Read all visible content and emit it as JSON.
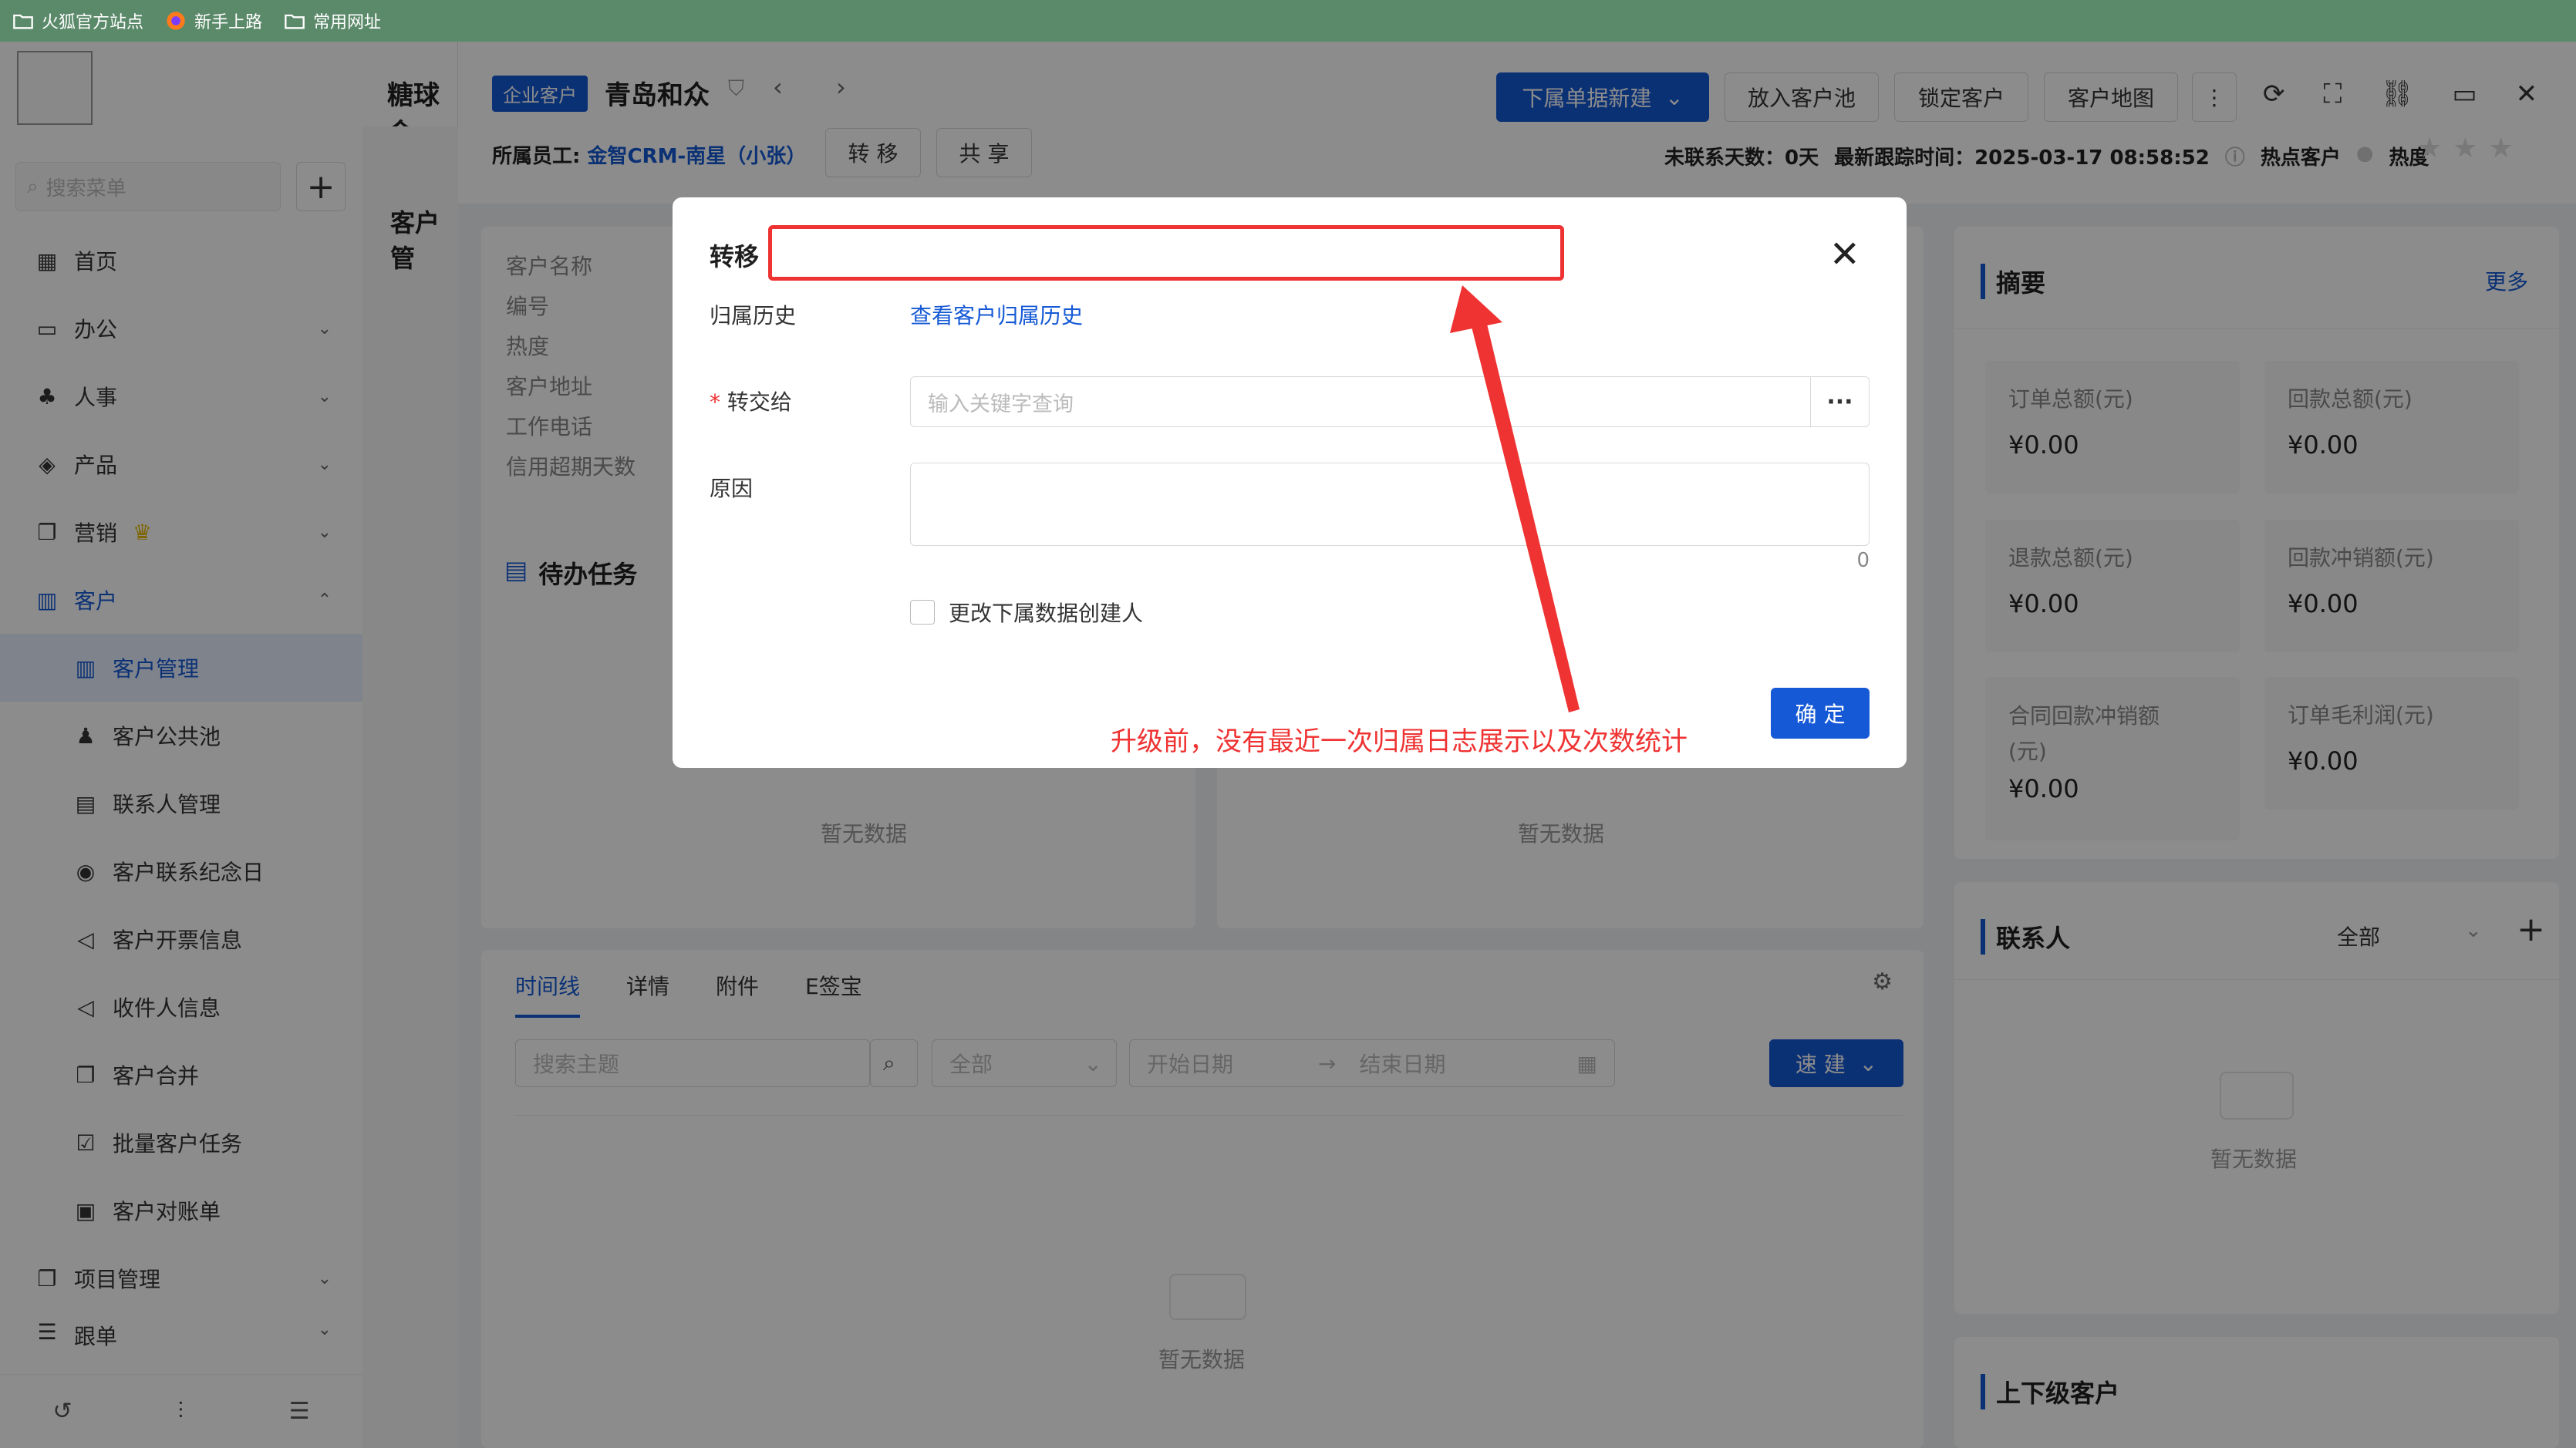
{
  "bookmarks": [
    {
      "label": "火狐官方站点"
    },
    {
      "label": "新手上路"
    },
    {
      "label": "常用网址"
    }
  ],
  "app": {
    "title": "糖球会"
  },
  "sidebar": {
    "search_placeholder": "搜索菜单",
    "items": [
      {
        "label": "首页"
      },
      {
        "label": "办公"
      },
      {
        "label": "人事"
      },
      {
        "label": "产品"
      },
      {
        "label": "营销"
      },
      {
        "label": "客户"
      },
      {
        "label": "客户管理"
      },
      {
        "label": "客户公共池"
      },
      {
        "label": "联系人管理"
      },
      {
        "label": "客户联系纪念日"
      },
      {
        "label": "客户开票信息"
      },
      {
        "label": "收件人信息"
      },
      {
        "label": "客户合并"
      },
      {
        "label": "批量客户任务"
      },
      {
        "label": "客户对账单"
      },
      {
        "label": "项目管理"
      },
      {
        "label": "跟单"
      }
    ],
    "sub_title": "客户管"
  },
  "header": {
    "tag": "企业客户",
    "customer_name": "青岛和众",
    "owner_label": "所属员工:",
    "owner_value": "金智CRM-南星（小张）",
    "transfer_btn": "转 移",
    "share_btn": "共 享",
    "sub_create_btn": "下属单据新建",
    "pool_btn": "放入客户池",
    "lock_btn": "锁定客户",
    "map_btn": "客户地图",
    "no_contact": "未联系天数：0天",
    "last_follow": "最新跟踪时间：2025-03-17 08:58:52",
    "hot_customer": "热点客户",
    "heat": "热度"
  },
  "details": {
    "labels": [
      "客户名称",
      "编号",
      "热度",
      "客户地址",
      "工作电话",
      "信用超期天数"
    ]
  },
  "todo": {
    "title": "待办任务",
    "empty": "暂无数据"
  },
  "summary": {
    "title": "摘要",
    "more": "更多",
    "stats": [
      {
        "label": "订单总额(元)",
        "value": "¥0.00"
      },
      {
        "label": "回款总额(元)",
        "value": "¥0.00"
      },
      {
        "label": "退款总额(元)",
        "value": "¥0.00"
      },
      {
        "label": "回款冲销额(元)",
        "value": "¥0.00"
      },
      {
        "label": "合同回款冲销额(元)",
        "value": "¥0.00"
      },
      {
        "label": "订单毛利润(元)",
        "value": "¥0.00"
      }
    ]
  },
  "contacts": {
    "title": "联系人",
    "filter": "全部",
    "empty": "暂无数据"
  },
  "parent_customers": {
    "title": "上下级客户"
  },
  "timeline": {
    "tabs": [
      "时间线",
      "详情",
      "附件",
      "E签宝"
    ],
    "search_placeholder": "搜索主题",
    "filter_all": "全部",
    "start_placeholder": "开始日期",
    "end_placeholder": "结束日期",
    "quick_create": "速 建",
    "empty": "暂无数据"
  },
  "modal": {
    "title": "转移",
    "history_label": "归属历史",
    "history_link": "查看客户归属历史",
    "transfer_to_label": "转交给",
    "transfer_to_placeholder": "输入关键字查询",
    "reason_label": "原因",
    "reason_count": "0",
    "checkbox_label": "更改下属数据创建人",
    "ok_btn": "确 定"
  },
  "annotation": {
    "text": "升级前，没有最近一次归属日志展示以及次数统计",
    "color": "#ef3232"
  },
  "colors": {
    "primary": "#1559d6",
    "bookmark_bar": "#5b8a6a",
    "annotation_red": "#ef3232"
  }
}
